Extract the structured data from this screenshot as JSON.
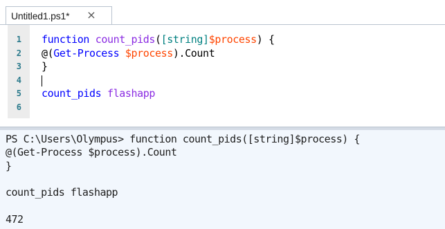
{
  "tab": {
    "title": "Untitled1.ps1*",
    "close_icon": "×"
  },
  "editor": {
    "lines": [
      {
        "number": "1",
        "tokens": [
          {
            "text": "function ",
            "kind": "kw"
          },
          {
            "text": "count_pids",
            "kind": "fn"
          },
          {
            "text": "(",
            "kind": "plain"
          },
          {
            "text": "[string]",
            "kind": "type"
          },
          {
            "text": "$process",
            "kind": "var"
          },
          {
            "text": ") {",
            "kind": "plain"
          }
        ]
      },
      {
        "number": "2",
        "tokens": [
          {
            "text": "@(",
            "kind": "plain"
          },
          {
            "text": "Get-Process",
            "kind": "kw"
          },
          {
            "text": " ",
            "kind": "plain"
          },
          {
            "text": "$process",
            "kind": "var"
          },
          {
            "text": ").Count",
            "kind": "plain"
          }
        ]
      },
      {
        "number": "3",
        "tokens": [
          {
            "text": "}",
            "kind": "plain"
          }
        ]
      },
      {
        "number": "4",
        "tokens": []
      },
      {
        "number": "5",
        "tokens": [
          {
            "text": "count_pids",
            "kind": "kw"
          },
          {
            "text": " ",
            "kind": "plain"
          },
          {
            "text": "flashapp",
            "kind": "fn"
          }
        ]
      },
      {
        "number": "6",
        "tokens": []
      }
    ],
    "caret_line": "4"
  },
  "console": {
    "lines": [
      "PS C:\\Users\\Olympus> function count_pids([string]$process) {",
      "@(Get-Process $process).Count",
      "}",
      "",
      "count_pids flashapp",
      "",
      "472"
    ]
  },
  "colors": {
    "kw": "#0000ff",
    "fn": "#8a2be2",
    "plain": "#000000",
    "type": "#008080",
    "var": "#ff4500",
    "line_number": "#2b7a8c",
    "console_bg": "#f2f7fd"
  }
}
